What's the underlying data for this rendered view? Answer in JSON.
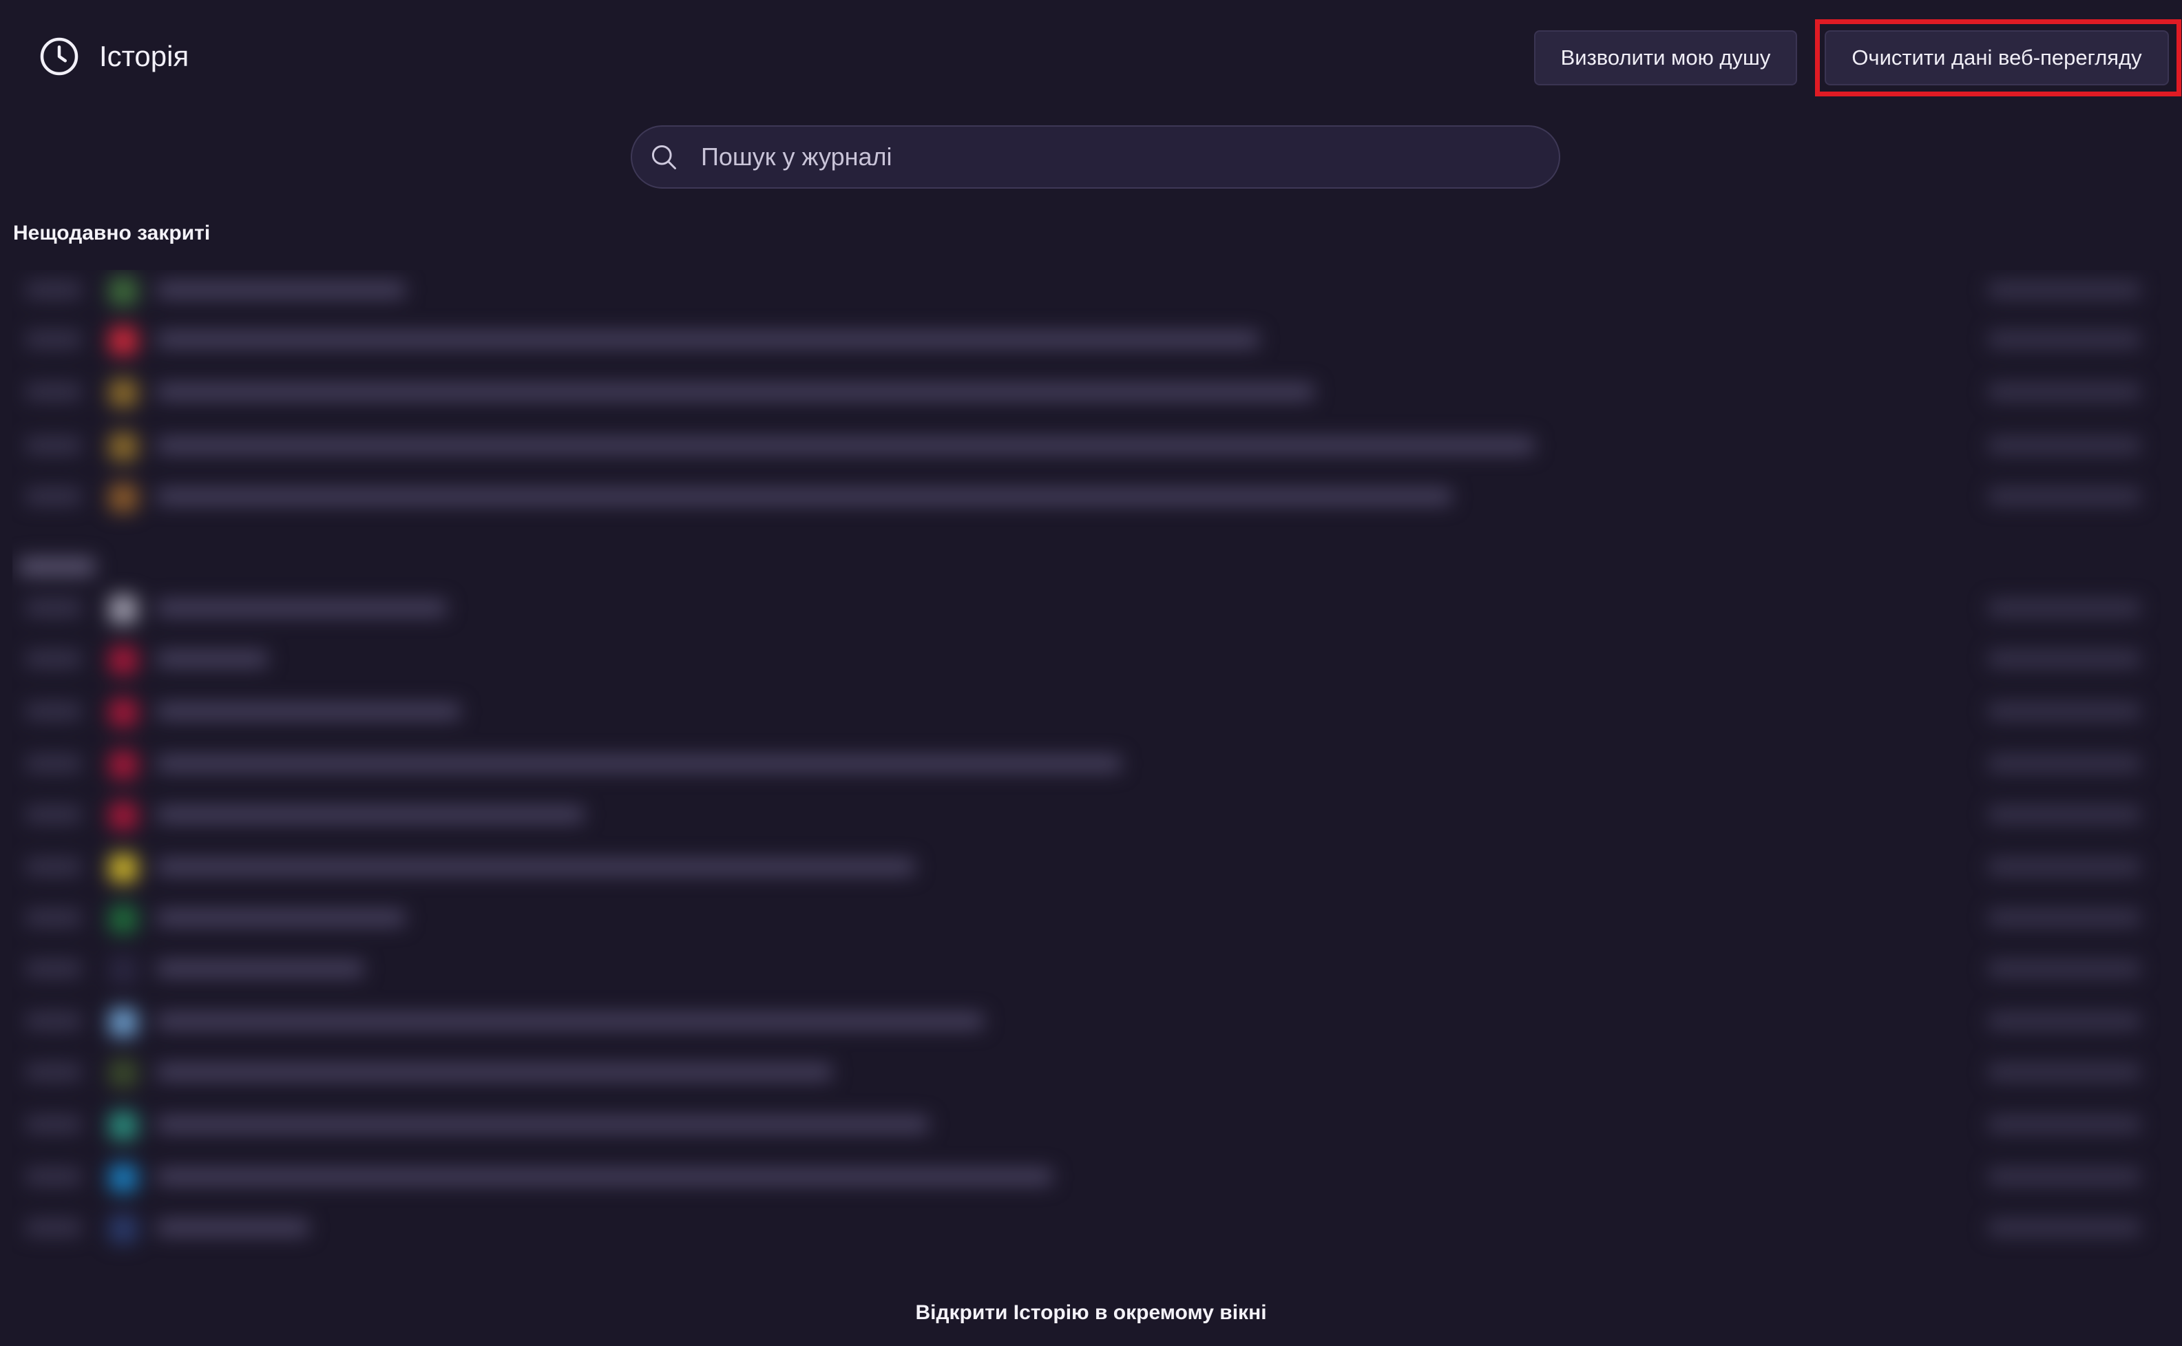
{
  "header": {
    "title": "Історія",
    "icon": "clock-icon",
    "release_soul_label": "Визволити мою душу",
    "clear_data_label": "Очистити дані веб-перегляду"
  },
  "search": {
    "placeholder": "Пошук у журналі",
    "value": ""
  },
  "sections": {
    "recently_closed_title": "Нещодавно закриті"
  },
  "footer": {
    "open_window_label": "Відкрити Історію в окремому вікні"
  },
  "colors": {
    "background": "#1b1728",
    "button_bg": "#2b2640",
    "highlight": "#e01b24"
  }
}
